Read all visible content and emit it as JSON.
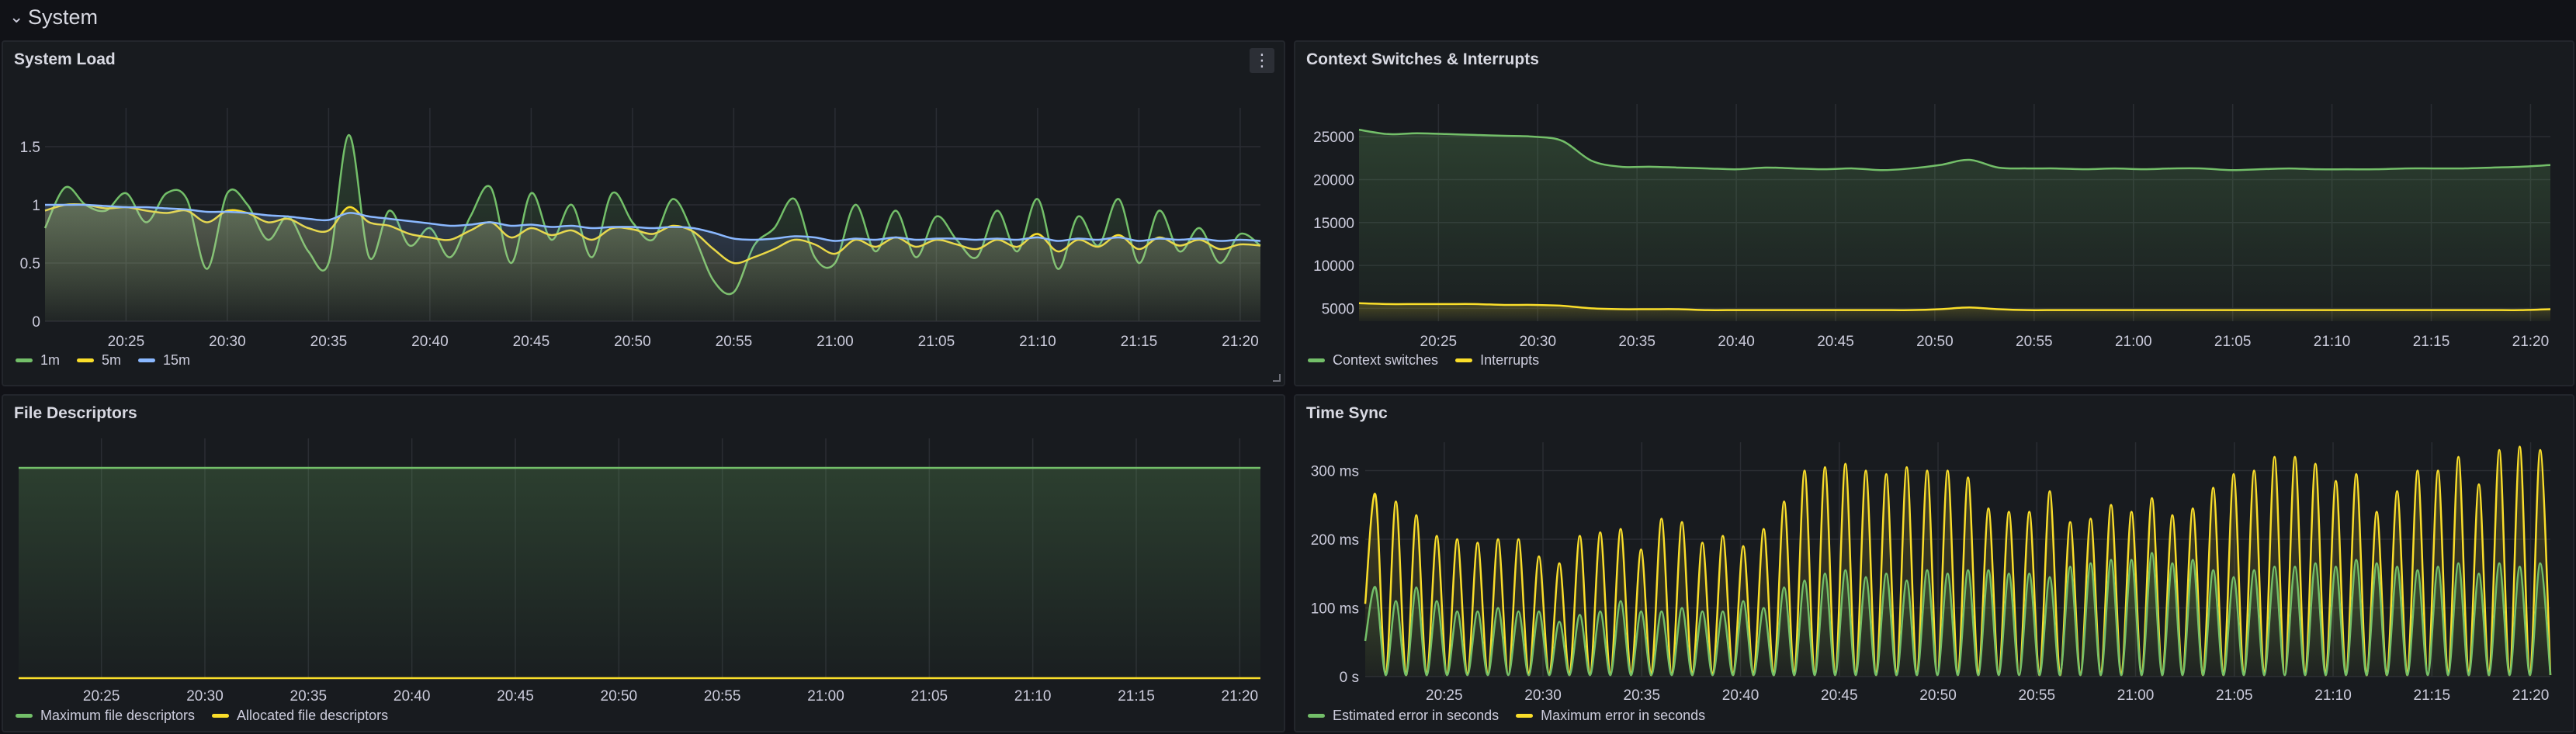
{
  "row": {
    "chevron": "chevron-down-icon",
    "title": "System"
  },
  "x_ticks": [
    "20:25",
    "20:30",
    "20:35",
    "20:40",
    "20:45",
    "20:50",
    "20:55",
    "21:00",
    "21:05",
    "21:10",
    "21:15",
    "21:20"
  ],
  "panels": {
    "system_load": {
      "title": "System Load",
      "menu_icon": "⋮",
      "legend": [
        {
          "label": "1m",
          "color": "#73bf69"
        },
        {
          "label": "5m",
          "color": "#fade2a"
        },
        {
          "label": "15m",
          "color": "#8ab8ff"
        }
      ],
      "chart_data": {
        "type": "line",
        "x": [
          "20:21",
          "20:22",
          "20:23",
          "20:24",
          "20:25",
          "20:26",
          "20:27",
          "20:28",
          "20:29",
          "20:30",
          "20:31",
          "20:32",
          "20:33",
          "20:34",
          "20:35",
          "20:36",
          "20:37",
          "20:38",
          "20:39",
          "20:40",
          "20:41",
          "20:42",
          "20:43",
          "20:44",
          "20:45",
          "20:46",
          "20:47",
          "20:48",
          "20:49",
          "20:50",
          "20:51",
          "20:52",
          "20:53",
          "20:54",
          "20:55",
          "20:56",
          "20:57",
          "20:58",
          "20:59",
          "21:00",
          "21:01",
          "21:02",
          "21:03",
          "21:04",
          "21:05",
          "21:06",
          "21:07",
          "21:08",
          "21:09",
          "21:10",
          "21:11",
          "21:12",
          "21:13",
          "21:14",
          "21:15",
          "21:16",
          "21:17",
          "21:18",
          "21:19",
          "21:20",
          "21:21"
        ],
        "ylim": [
          0,
          1.7
        ],
        "yticks": [
          "0",
          "0.5",
          "1",
          "1.5"
        ],
        "series": [
          {
            "name": "1m",
            "color": "#73bf69",
            "values": [
              0.8,
              1.15,
              1.0,
              0.95,
              1.1,
              0.85,
              1.1,
              1.05,
              0.45,
              1.1,
              1.0,
              0.7,
              0.9,
              0.6,
              0.5,
              1.6,
              0.55,
              0.95,
              0.65,
              0.8,
              0.55,
              0.9,
              1.15,
              0.5,
              1.1,
              0.7,
              1.0,
              0.55,
              1.1,
              0.85,
              0.7,
              1.05,
              0.75,
              0.35,
              0.25,
              0.65,
              0.8,
              1.05,
              0.55,
              0.5,
              1.0,
              0.6,
              0.95,
              0.55,
              0.9,
              0.7,
              0.55,
              0.95,
              0.6,
              1.05,
              0.45,
              0.9,
              0.65,
              1.05,
              0.5,
              0.95,
              0.6,
              0.8,
              0.5,
              0.75,
              0.65
            ]
          },
          {
            "name": "5m",
            "color": "#fade2a",
            "values": [
              0.95,
              1.0,
              1.0,
              0.97,
              0.98,
              0.95,
              0.93,
              0.95,
              0.85,
              0.95,
              0.93,
              0.85,
              0.88,
              0.8,
              0.78,
              0.98,
              0.85,
              0.82,
              0.75,
              0.72,
              0.7,
              0.78,
              0.85,
              0.72,
              0.8,
              0.74,
              0.78,
              0.7,
              0.8,
              0.79,
              0.75,
              0.82,
              0.77,
              0.62,
              0.5,
              0.55,
              0.62,
              0.7,
              0.66,
              0.58,
              0.7,
              0.64,
              0.72,
              0.64,
              0.7,
              0.66,
              0.62,
              0.7,
              0.64,
              0.75,
              0.6,
              0.7,
              0.64,
              0.74,
              0.62,
              0.72,
              0.65,
              0.7,
              0.62,
              0.66,
              0.65
            ]
          },
          {
            "name": "15m",
            "color": "#8ab8ff",
            "values": [
              1.0,
              1.0,
              1.0,
              0.99,
              0.98,
              0.98,
              0.97,
              0.96,
              0.94,
              0.94,
              0.93,
              0.91,
              0.9,
              0.88,
              0.87,
              0.93,
              0.9,
              0.88,
              0.86,
              0.84,
              0.82,
              0.83,
              0.85,
              0.82,
              0.83,
              0.81,
              0.82,
              0.8,
              0.81,
              0.81,
              0.8,
              0.81,
              0.8,
              0.76,
              0.71,
              0.7,
              0.71,
              0.73,
              0.72,
              0.69,
              0.71,
              0.7,
              0.72,
              0.7,
              0.71,
              0.71,
              0.7,
              0.71,
              0.7,
              0.72,
              0.69,
              0.71,
              0.7,
              0.72,
              0.69,
              0.71,
              0.7,
              0.71,
              0.69,
              0.7,
              0.69
            ]
          }
        ]
      }
    },
    "context_switches": {
      "title": "Context Switches & Interrupts",
      "legend": [
        {
          "label": "Context switches",
          "color": "#73bf69"
        },
        {
          "label": "Interrupts",
          "color": "#fade2a"
        }
      ],
      "chart_data": {
        "type": "line",
        "ylim": [
          3500,
          27000
        ],
        "yticks": [
          "5000",
          "10000",
          "15000",
          "20000",
          "25000"
        ],
        "series": [
          {
            "name": "Context switches",
            "color": "#73bf69",
            "values": [
              25800,
              25300,
              25400,
              25300,
              25200,
              25100,
              25000,
              24500,
              22200,
              21500,
              21500,
              21400,
              21300,
              21200,
              21400,
              21300,
              21200,
              21300,
              21100,
              21300,
              21700,
              22300,
              21400,
              21300,
              21300,
              21200,
              21300,
              21200,
              21300,
              21300,
              21100,
              21200,
              21300,
              21200,
              21200,
              21200,
              21300,
              21300,
              21300,
              21400,
              21500,
              21700
            ]
          },
          {
            "name": "Interrupts",
            "color": "#fade2a",
            "values": [
              5600,
              5500,
              5500,
              5500,
              5500,
              5400,
              5400,
              5300,
              5000,
              4900,
              4900,
              4900,
              4800,
              4800,
              4800,
              4800,
              4800,
              4800,
              4800,
              4800,
              4900,
              5100,
              4900,
              4800,
              4800,
              4800,
              4800,
              4800,
              4800,
              4800,
              4800,
              4800,
              4800,
              4800,
              4800,
              4800,
              4800,
              4800,
              4800,
              4800,
              4800,
              4900
            ]
          }
        ]
      }
    },
    "file_descriptors": {
      "title": "File Descriptors",
      "legend": [
        {
          "label": "Maximum file descriptors",
          "color": "#73bf69"
        },
        {
          "label": "Allocated file descriptors",
          "color": "#fade2a"
        }
      ],
      "chart_data": {
        "type": "line",
        "ylim": [
          0,
          1
        ],
        "series": [
          {
            "name": "Maximum file descriptors",
            "color": "#73bf69",
            "values": [
              0.97,
              0.97
            ]
          },
          {
            "name": "Allocated file descriptors",
            "color": "#fade2a",
            "values": [
              0.0,
              0.0
            ]
          }
        ]
      }
    },
    "time_sync": {
      "title": "Time Sync",
      "legend": [
        {
          "label": "Estimated error in seconds",
          "color": "#73bf69"
        },
        {
          "label": "Maximum error in seconds",
          "color": "#fade2a"
        }
      ],
      "chart_data": {
        "type": "line",
        "ylim": [
          0,
          330
        ],
        "yticks": [
          "0 s",
          "100 ms",
          "200 ms",
          "300 ms"
        ],
        "series": [
          {
            "name": "Estimated error in seconds",
            "color": "#73bf69",
            "peaks": [
              130,
              110,
              130,
              110,
              95,
              95,
              100,
              95,
              95,
              80,
              90,
              95,
              110,
              95,
              95,
              100,
              95,
              95,
              110,
              100,
              130,
              140,
              150,
              155,
              145,
              150,
              140,
              155,
              150,
              155,
              155,
              150,
              150,
              145,
              160,
              165,
              170,
              170,
              180,
              165,
              170,
              155,
              145,
              155,
              160,
              160,
              165,
              160,
              170,
              165,
              160,
              155,
              160,
              165,
              150,
              165,
              160,
              165
            ]
          },
          {
            "name": "Maximum error in seconds",
            "color": "#fade2a",
            "peaks": [
              265,
              255,
              235,
              205,
              200,
              195,
              200,
              200,
              175,
              165,
              205,
              210,
              215,
              185,
              230,
              225,
              195,
              205,
              190,
              215,
              255,
              300,
              305,
              310,
              300,
              295,
              305,
              300,
              300,
              290,
              245,
              240,
              240,
              270,
              225,
              230,
              250,
              240,
              260,
              235,
              245,
              275,
              295,
              300,
              320,
              320,
              310,
              285,
              295,
              240,
              270,
              300,
              300,
              320,
              280,
              330,
              335,
              330
            ]
          }
        ]
      }
    }
  }
}
